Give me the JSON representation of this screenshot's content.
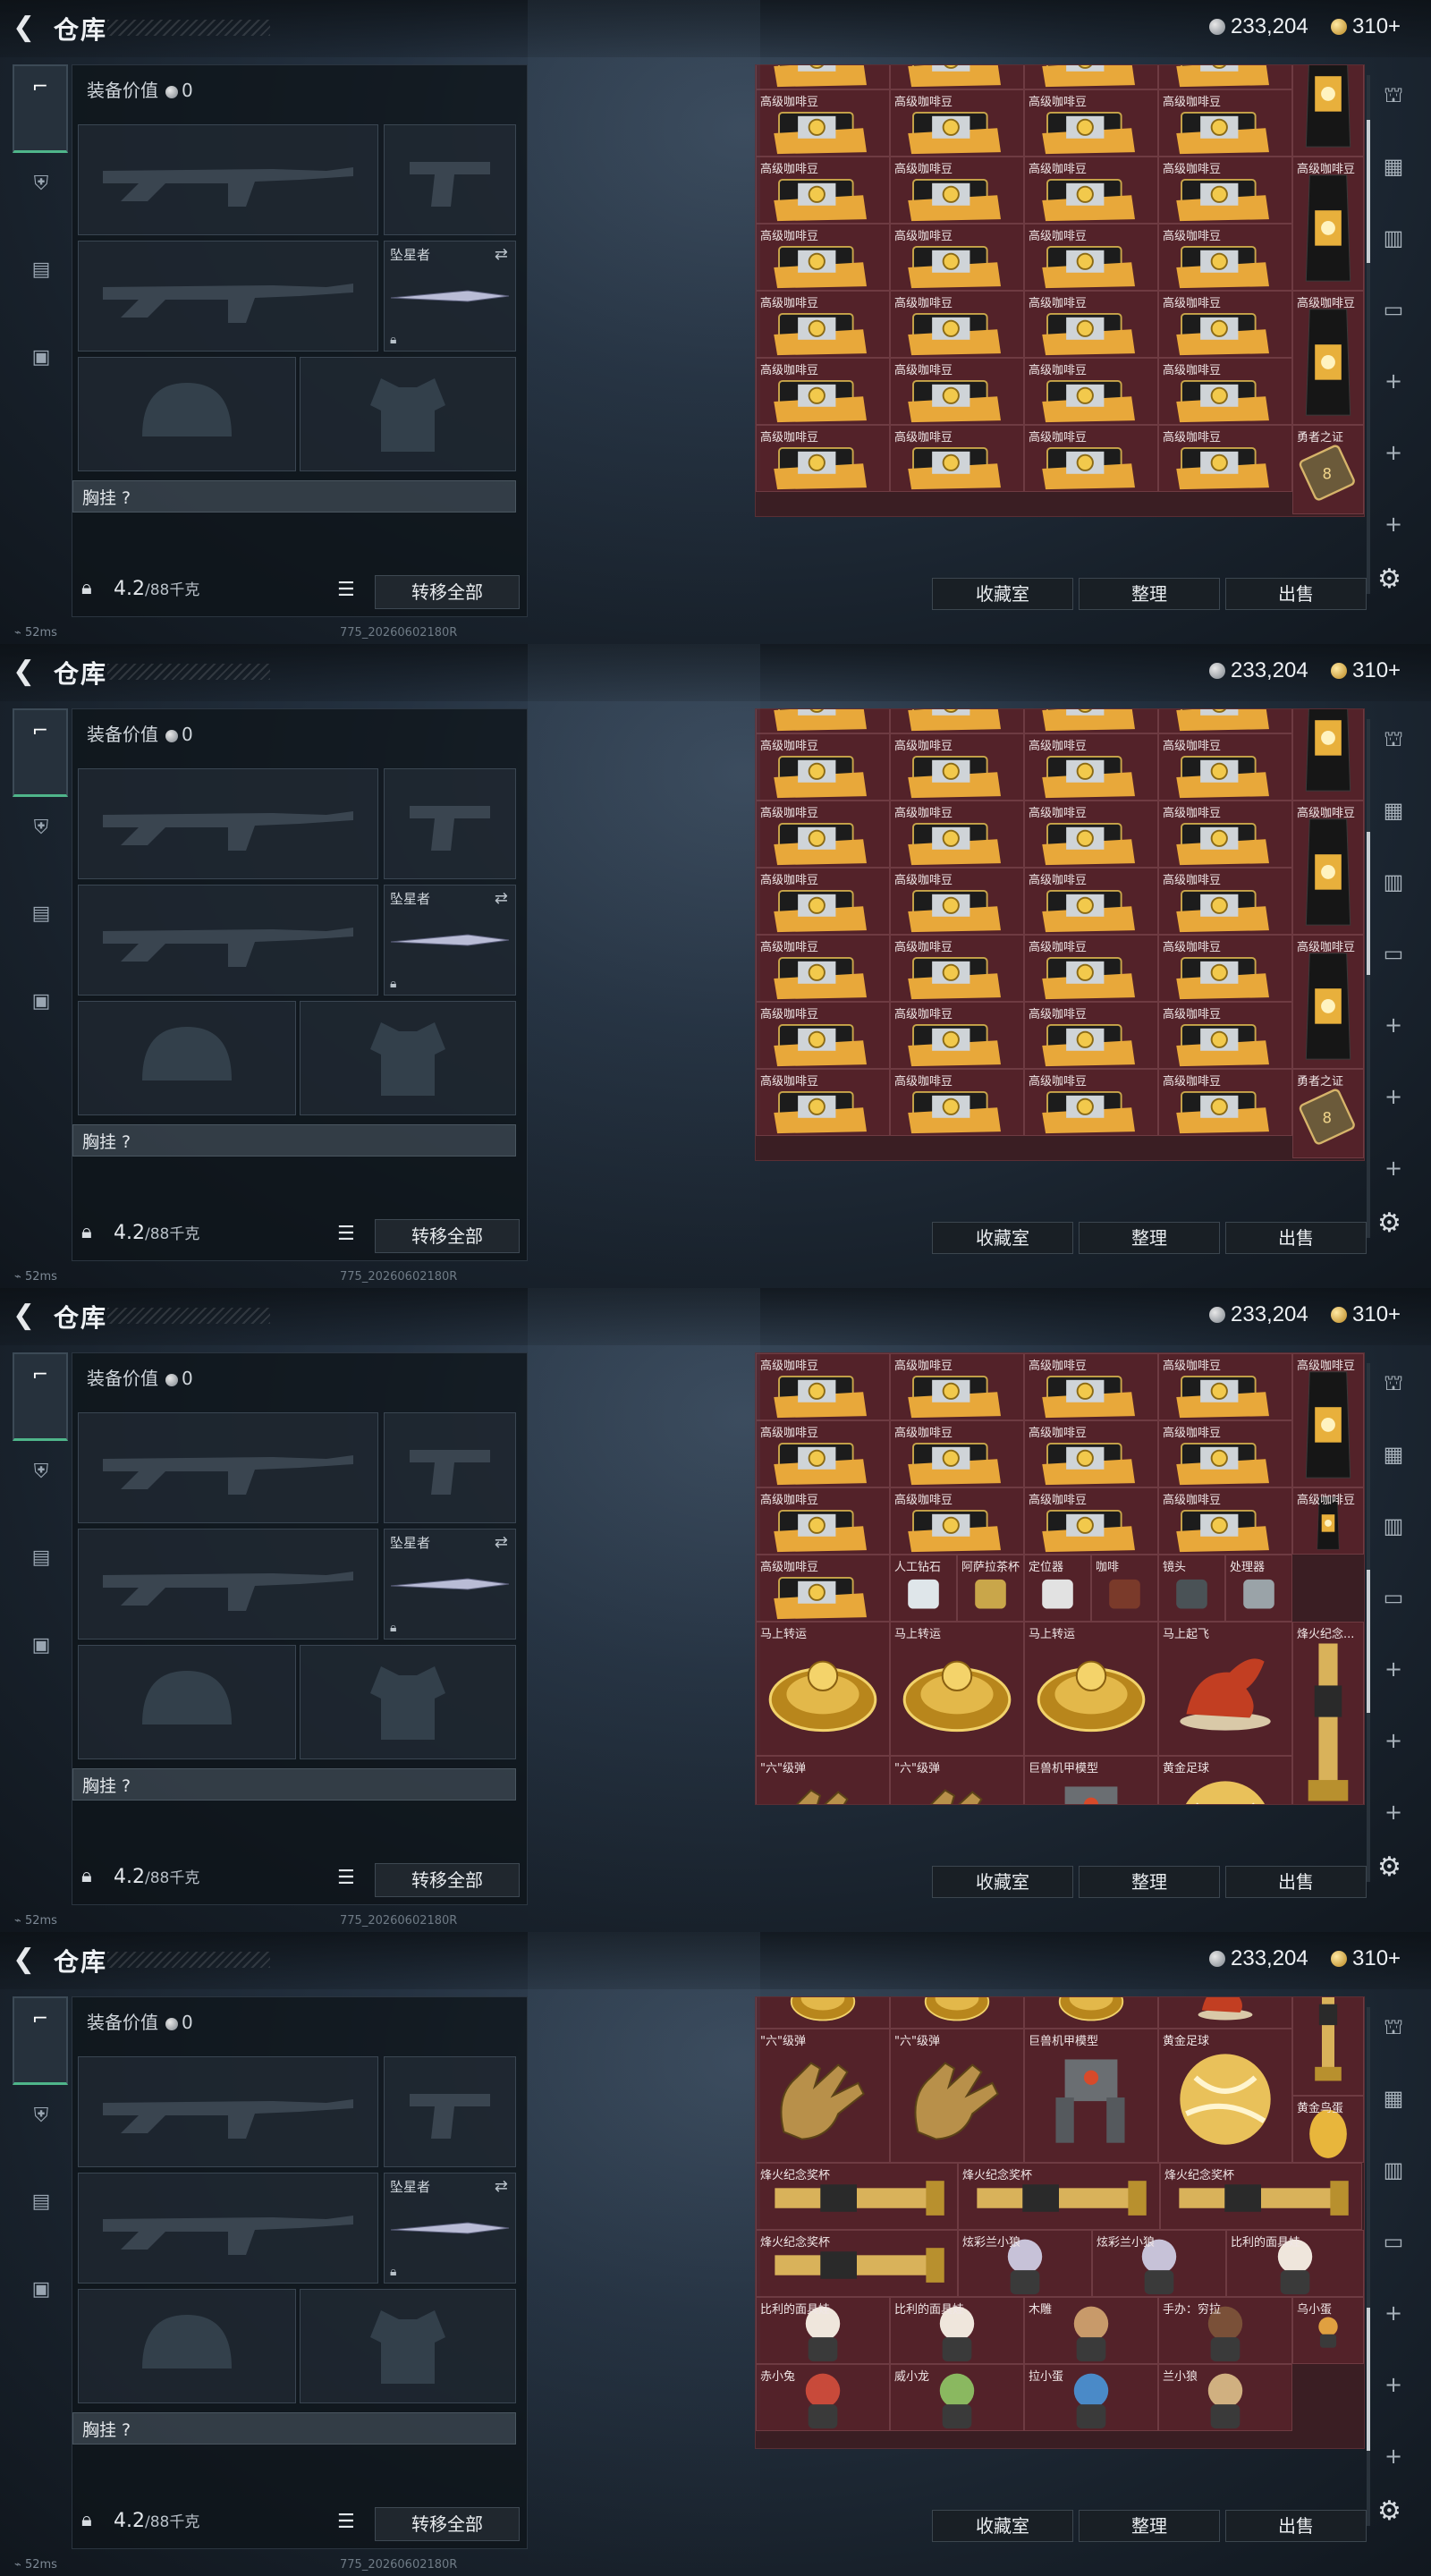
{
  "header": {
    "title": "仓库",
    "currency_silver": "233,204",
    "currency_gold": "310+"
  },
  "left_tabs": [
    "gun-icon",
    "armor-icon",
    "clipboard-icon",
    "briefcase-icon"
  ],
  "equipment": {
    "value_label": "装备价值",
    "value": "0",
    "melee_name": "坠星者",
    "chest_label": "胸挂 ?",
    "weight": "4.2",
    "weight_max": "/88千克",
    "transfer_all": "转移全部"
  },
  "bottom_buttons": {
    "collection": "收藏室",
    "sort": "整理",
    "sell": "出售"
  },
  "status": {
    "latency": "52ms",
    "build": "775_20260602180R"
  },
  "panels": [
    {
      "grid": {
        "cols": 4,
        "rows": [
          [
            "",
            "",
            "",
            ""
          ],
          [
            "高级咖啡豆",
            "高级咖啡豆",
            "高级咖啡豆",
            "高级咖啡豆"
          ],
          [
            "高级咖啡豆",
            "高级咖啡豆",
            "高级咖啡豆",
            "高级咖啡豆"
          ],
          [
            "高级咖啡豆",
            "高级咖啡豆",
            "高级咖啡豆",
            "高级咖啡豆"
          ],
          [
            "高级咖啡豆",
            "高级咖啡豆",
            "高级咖啡豆",
            "高级咖啡豆"
          ],
          [
            "高级咖啡豆",
            "高级咖啡豆",
            "高级咖啡豆",
            "高级咖啡豆"
          ],
          [
            "高级咖啡豆",
            "高级咖啡豆",
            "高级咖啡豆",
            "高级咖啡豆"
          ]
        ],
        "side": [
          "",
          "高级咖啡豆",
          "高级咖啡豆",
          "勇者之证"
        ]
      },
      "scroll": 0.12
    },
    {
      "grid": {
        "cols": 4,
        "rows": [
          [
            "",
            "",
            "",
            ""
          ],
          [
            "高级咖啡豆",
            "高级咖啡豆",
            "高级咖啡豆",
            "高级咖啡豆"
          ],
          [
            "高级咖啡豆",
            "高级咖啡豆",
            "高级咖啡豆",
            "高级咖啡豆"
          ],
          [
            "高级咖啡豆",
            "高级咖啡豆",
            "高级咖啡豆",
            "高级咖啡豆"
          ],
          [
            "高级咖啡豆",
            "高级咖啡豆",
            "高级咖啡豆",
            "高级咖啡豆"
          ],
          [
            "高级咖啡豆",
            "高级咖啡豆",
            "高级咖啡豆",
            "高级咖啡豆"
          ],
          [
            "高级咖啡豆",
            "高级咖啡豆",
            "高级咖啡豆",
            "高级咖啡豆"
          ]
        ],
        "side": [
          "",
          "高级咖啡豆",
          "高级咖啡豆",
          "勇者之证"
        ]
      },
      "scroll": 0.3
    },
    {
      "rows3": [
        [
          "高级咖啡豆",
          "高级咖啡豆",
          "高级咖啡豆",
          "高级咖啡豆"
        ],
        [
          "高级咖啡豆",
          "高级咖啡豆",
          "高级咖啡豆",
          "高级咖啡豆"
        ],
        [
          "高级咖啡豆",
          "高级咖啡豆",
          "高级咖啡豆",
          "高级咖啡豆"
        ]
      ],
      "mixed_row": [
        "高级咖啡豆",
        "人工钻石",
        "阿萨拉茶杯",
        "定位器",
        "咖啡",
        "镜头",
        "处理器"
      ],
      "big_row1": [
        "马上转运",
        "马上转运",
        "马上转运",
        "马上起飞"
      ],
      "side_big": "烽火纪念...",
      "big_row2": [
        "\"六\"级弹",
        "\"六\"级弹",
        "巨兽机甲模型",
        "黄金足球"
      ],
      "side_big2": "黄金鸟蛋",
      "side_top": [
        "高级咖啡豆",
        "高级咖啡豆"
      ],
      "scroll": 0.55
    },
    {
      "big_row2": [
        "\"六\"级弹",
        "\"六\"级弹",
        "巨兽机甲模型",
        "黄金足球"
      ],
      "side_big2": "黄金鸟蛋",
      "trophy_row": [
        "烽火纪念奖杯",
        "烽火纪念奖杯",
        "烽火纪念奖杯"
      ],
      "mixed_row2": [
        "烽火纪念奖杯",
        "炫彩兰小狼",
        "炫彩兰小狼",
        "比利的面具娃"
      ],
      "figure_row1": [
        "比利的面具娃",
        "比利的面具娃",
        "木雕",
        "手办：穷拉",
        "乌小蛋"
      ],
      "figure_row2": [
        "赤小兔",
        "威小龙",
        "拉小蛋",
        "兰小狼"
      ],
      "scroll": 0.8
    }
  ]
}
